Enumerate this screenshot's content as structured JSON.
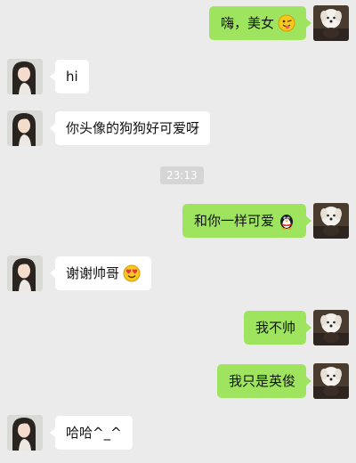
{
  "chat": {
    "messages": [
      {
        "from": "me",
        "text": "嗨，美女",
        "emoji": "winking-tongue-emoji-icon"
      },
      {
        "from": "them",
        "text": "hi"
      },
      {
        "from": "them",
        "text": "你头像的狗狗好可爱呀"
      },
      {
        "from": "me",
        "text": "和你一样可爱",
        "emoji": "penguin-emoji-icon"
      },
      {
        "from": "them",
        "text": "谢谢帅哥",
        "emoji": "heart-eyes-emoji-icon"
      },
      {
        "from": "me",
        "text": "我不帅"
      },
      {
        "from": "me",
        "text": "我只是英俊"
      },
      {
        "from": "them",
        "text": "哈哈^_^"
      }
    ],
    "timestamp": "23:13"
  },
  "colors": {
    "background": "#ebebeb",
    "my_bubble": "#9fe45f",
    "their_bubble": "#ffffff",
    "time_badge": "#d5d5d5"
  },
  "icons": {
    "my_avatar": "dog-avatar-icon",
    "their_avatar": "girl-avatar-icon"
  }
}
